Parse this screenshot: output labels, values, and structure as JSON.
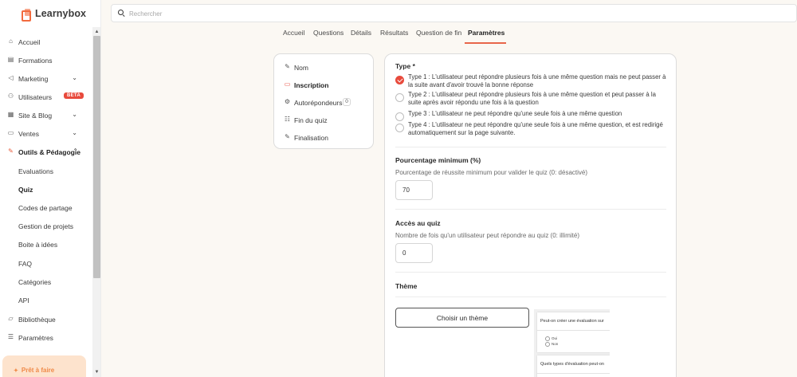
{
  "app": {
    "name": "Learnybox"
  },
  "search": {
    "placeholder": "Rechercher"
  },
  "sidebar": {
    "items": [
      {
        "label": "Accueil",
        "icon": "home-icon"
      },
      {
        "label": "Formations",
        "icon": "book-icon"
      },
      {
        "label": "Marketing",
        "icon": "megaphone-icon"
      },
      {
        "label": "Utilisateurs",
        "icon": "users-icon",
        "badge": "BETA"
      },
      {
        "label": "Site & Blog",
        "icon": "grid-icon"
      },
      {
        "label": "Ventes",
        "icon": "wallet-icon"
      },
      {
        "label": "Outils & Pédagogie",
        "icon": "tools-icon"
      },
      {
        "label": "Bibliothèque",
        "icon": "folder-icon"
      },
      {
        "label": "Paramètres",
        "icon": "sliders-icon"
      }
    ],
    "sub_items": [
      "Evaluations",
      "Quiz",
      "Codes de partage",
      "Gestion de projets",
      "Boite à idées",
      "FAQ",
      "Catégories",
      "API"
    ],
    "promo": {
      "title": "Prêt à faire"
    }
  },
  "tabs": [
    "Accueil",
    "Questions",
    "Détails",
    "Résultats",
    "Question de fin",
    "Paramètres"
  ],
  "settings_menu": [
    {
      "label": "Nom",
      "icon": "edit-icon"
    },
    {
      "label": "Inscription",
      "icon": "form-icon"
    },
    {
      "label": "Autorépondeurs",
      "icon": "autoresponder-icon",
      "count": "0"
    },
    {
      "label": "Fin du quiz",
      "icon": "list-icon"
    },
    {
      "label": "Finalisation",
      "icon": "edit-icon"
    }
  ],
  "type_section": {
    "title": "Type *",
    "options": [
      "Type 1 : L'utilisateur peut répondre plusieurs fois à une même question mais ne peut passer à la suite avant d'avoir trouvé la bonne réponse",
      "Type 2 : L'utilisateur peut répondre plusieurs fois à une même question et peut passer à la suite après avoir répondu une fois à la question",
      "Type 3 : L'utilisateur ne peut répondre qu'une seule fois à une même question",
      "Type 4 : L'utilisateur ne peut répondre qu'une seule fois à une même question, et est redirigé automatiquement sur la page suivante."
    ],
    "selected_index": 0
  },
  "min_percentage": {
    "title": "Pourcentage minimum (%)",
    "help": "Pourcentage de réussite minimum pour valider le quiz (0: désactivé)",
    "value": "70"
  },
  "quiz_access": {
    "title": "Accès au quiz",
    "help": "Nombre de fois qu'un utilisateur peut répondre au quiz (0: illimité)",
    "value": "0"
  },
  "theme": {
    "title": "Thème",
    "button_label": "Choisir un thème",
    "preview": {
      "question_1": "Peut-on créer une évaluation sur",
      "options": [
        "Oui",
        "Non"
      ],
      "question_2": "Quels types d'évaluation peut-on"
    }
  },
  "colors": {
    "accent": "#e84a3c",
    "brand": "#f26a3e",
    "background": "#fbf8f3"
  }
}
